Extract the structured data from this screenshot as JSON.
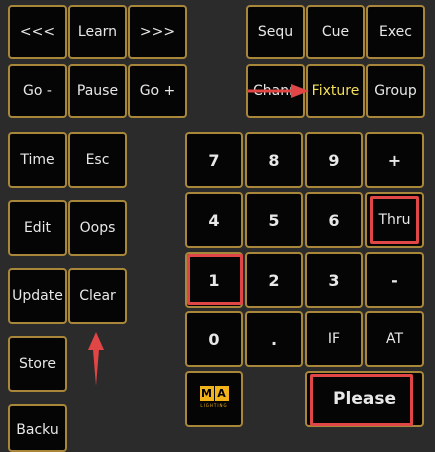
{
  "keys": {
    "back3": "<<<",
    "learn": "Learn",
    "fwd3": ">>>",
    "sequ": "Sequ",
    "cue": "Cue",
    "exec": "Exec",
    "go_minus": "Go -",
    "pause": "Pause",
    "go_plus": "Go +",
    "chann": "Chann",
    "fixture": "Fixture",
    "group": "Group",
    "time": "Time",
    "esc": "Esc",
    "edit": "Edit",
    "oops": "Oops",
    "update": "Update",
    "clear": "Clear",
    "store": "Store",
    "backup": "Backu",
    "n7": "7",
    "n8": "8",
    "n9": "9",
    "plus": "+",
    "n4": "4",
    "n5": "5",
    "n6": "6",
    "thru": "Thru",
    "n1": "1",
    "n2": "2",
    "n3": "3",
    "minus": "-",
    "n0": "0",
    "dot": ".",
    "if": "IF",
    "at": "AT",
    "please": "Please"
  },
  "logo": {
    "letters": [
      "M",
      "A"
    ],
    "sub": "LIGHTING"
  },
  "colors": {
    "highlight": "#e04646",
    "fixture_text": "#f5e05a",
    "key_border": "#a8863a",
    "brand": "#f2b21a"
  }
}
